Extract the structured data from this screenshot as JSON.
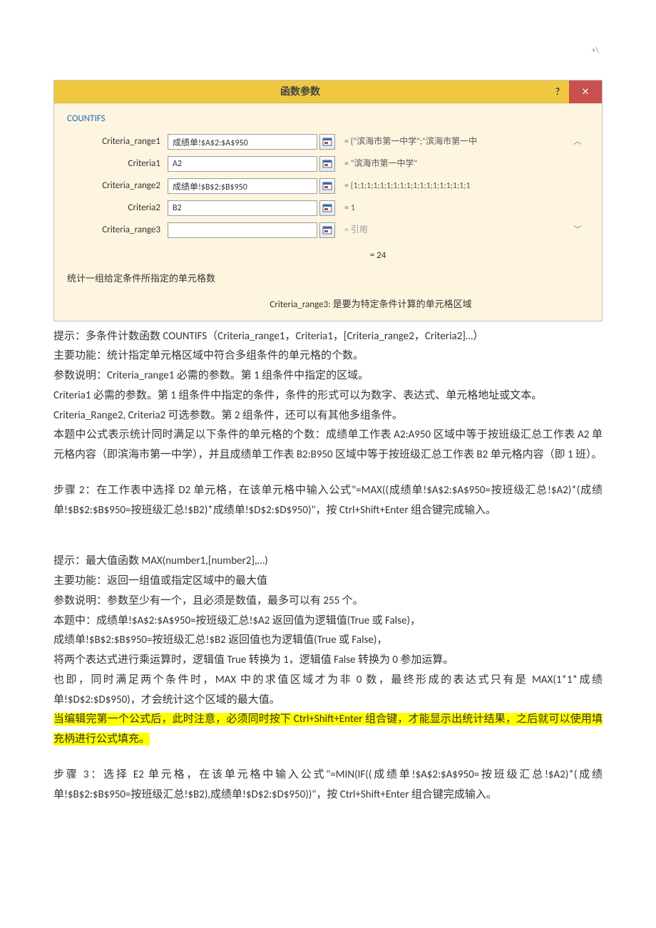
{
  "page_marker": "+\\",
  "dialog": {
    "title": "函数参数",
    "help": "?",
    "close": "×",
    "func_name": "COUNTIFS",
    "params": [
      {
        "label": "Criteria_range1",
        "value": "成绩单!$A$2:$A$950",
        "eval": "= {\"滨海市第一中学\";\"滨海市第一中"
      },
      {
        "label": "Criteria1",
        "value": "A2",
        "eval": "= \"滨海市第一中学\""
      },
      {
        "label": "Criteria_range2",
        "value": "成绩单!$B$2:$B$950",
        "eval": "= {1;1;1;1;1;1;1;1;1;1;1;1;1;1;1;1;1;1"
      },
      {
        "label": "Criteria2",
        "value": "B2",
        "eval": "= 1"
      },
      {
        "label": "Criteria_range3",
        "value": "",
        "eval": "= 引用"
      }
    ],
    "result": "= 24",
    "desc1": "统计一组给定条件所指定的单元格数",
    "desc2": "Criteria_range3:  是要为特定条件计算的单元格区域"
  },
  "doc": {
    "p1": "提示：多条件计数函数 COUNTIFS（Criteria_range1，Criteria1，[Criteria_range2，Criteria2]…）",
    "p2": "主要功能：统计指定单元格区域中符合多组条件的单元格的个数。",
    "p3": "参数说明：Criteria_range1 必需的参数。第 1 组条件中指定的区域。",
    "p4": "Criteria1 必需的参数。第 1 组条件中指定的条件，条件的形式可以为数字、表达式、单元格地址或文本。",
    "p5": "Criteria_Range2, Criteria2  可选参数。第 2 组条件，还可以有其他多组条件。",
    "p6": "本题中公式表示统计同时满足以下条件的单元格的个数：成绩单工作表 A2:A950 区域中等于按班级汇总工作表 A2 单元格内容（即滨海市第一中学），并且成绩单工作表 B2:B950 区域中等于按班级汇总工作表 B2 单元格内容（即 1 班）。",
    "p7": "步骤 2：在工作表中选择 D2 单元格，在该单元格中输入公式\"=MAX((成绩单!$A$2:$A$950=按班级汇总!$A2)*(成绩单!$B$2:$B$950=按班级汇总!$B2)*成绩单!$D$2:$D$950)\"，按 Ctrl+Shift+Enter 组合键完成输入。",
    "p8": "提示：最大值函数 MAX(number1,[number2],…)",
    "p9": "主要功能：返回一组值或指定区域中的最大值",
    "p10": "参数说明：参数至少有一个，且必须是数值，最多可以有 255 个。",
    "p11": "本题中：成绩单!$A$2:$A$950=按班级汇总!$A2 返回值为逻辑值(True 或 False)，",
    "p12": "成绩单!$B$2:$B$950=按班级汇总!$B2 返回值也为逻辑值(True 或 False)，",
    "p13": "将两个表达式进行乘运算时，逻辑值 True 转换为 1，逻辑值 False 转换为 0 参加运算。",
    "p14": "也即，同时满足两个条件时，MAX 中的求值区域才为非 0 数，最终形成的表达式只有是 MAX(1*1*成绩单!$D$2:$D$950)，才会统计这个区域的最大值。",
    "p15": "当编辑完第一个公式后，此时注意，必须同时按下 Ctrl+Shift+Enter 组合键，才能显示出统计结果，之后就可以使用填充柄进行公式填充。",
    "p16": "步骤 3：选择 E2 单元格，在该单元格中输入公式\"=MIN(IF((成绩单!$A$2:$A$950=按班级汇总!$A2)*(成绩单!$B$2:$B$950=按班级汇总!$B2),成绩单!$D$2:$D$950))\"，按 Ctrl+Shift+Enter 组合键完成输入。"
  }
}
